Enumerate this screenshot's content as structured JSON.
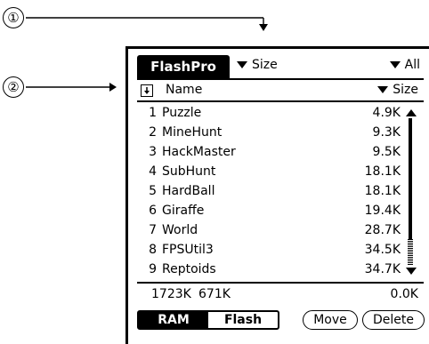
{
  "callouts": [
    "①",
    "②"
  ],
  "app": {
    "title": "FlashPro",
    "sort_label": "Size",
    "filter_label": "All"
  },
  "columns": {
    "name": "Name",
    "size": "Size"
  },
  "rows": [
    {
      "index": "1",
      "name": "Puzzle",
      "size": "4.9K"
    },
    {
      "index": "2",
      "name": "MineHunt",
      "size": "9.3K"
    },
    {
      "index": "3",
      "name": "HackMaster",
      "size": "9.5K"
    },
    {
      "index": "4",
      "name": "SubHunt",
      "size": "18.1K"
    },
    {
      "index": "5",
      "name": "HardBall",
      "size": "18.1K"
    },
    {
      "index": "6",
      "name": "Giraffe",
      "size": "19.4K"
    },
    {
      "index": "7",
      "name": "World",
      "size": "28.7K"
    },
    {
      "index": "8",
      "name": "FPSUtil3",
      "size": "34.5K"
    },
    {
      "index": "9",
      "name": "Reptoids",
      "size": "34.7K"
    }
  ],
  "stats": {
    "ram": "1723K",
    "flash": "671K",
    "selected": "0.0K"
  },
  "segment": {
    "ram": "RAM",
    "flash": "Flash",
    "active": "ram"
  },
  "buttons": {
    "move": "Move",
    "delete": "Delete"
  }
}
